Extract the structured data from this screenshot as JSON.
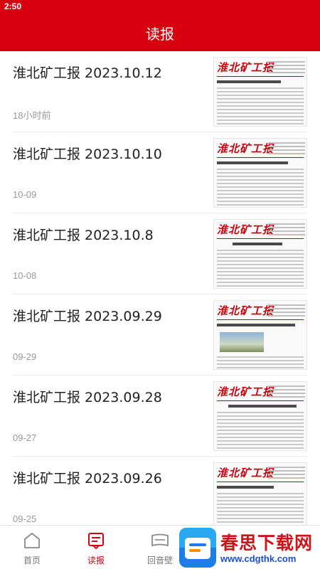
{
  "status_bar": {
    "time": "2:50"
  },
  "header": {
    "title": "读报"
  },
  "newspaper_masthead": "淮北矿工报",
  "items": [
    {
      "title": "淮北矿工报 2023.10.12",
      "date": "18小时前"
    },
    {
      "title": "淮北矿工报 2023.10.10",
      "date": "10-09"
    },
    {
      "title": "淮北矿工报 2023.10.8",
      "date": "10-08"
    },
    {
      "title": "淮北矿工报 2023.09.29",
      "date": "09-29"
    },
    {
      "title": "淮北矿工报 2023.09.28",
      "date": "09-27"
    },
    {
      "title": "淮北矿工报 2023.09.26",
      "date": "09-25"
    }
  ],
  "tabbar": {
    "tabs": [
      {
        "label": "首页",
        "icon": "home-icon"
      },
      {
        "label": "读报",
        "icon": "newspaper-icon",
        "active": true
      },
      {
        "label": "回音壁",
        "icon": "board-icon"
      }
    ]
  },
  "watermark": {
    "title": "春思下载网",
    "url": "www.cdgthk.com"
  },
  "colors": {
    "brand_red": "#d7000f",
    "text": "#222222",
    "muted": "#9a9a9a"
  }
}
